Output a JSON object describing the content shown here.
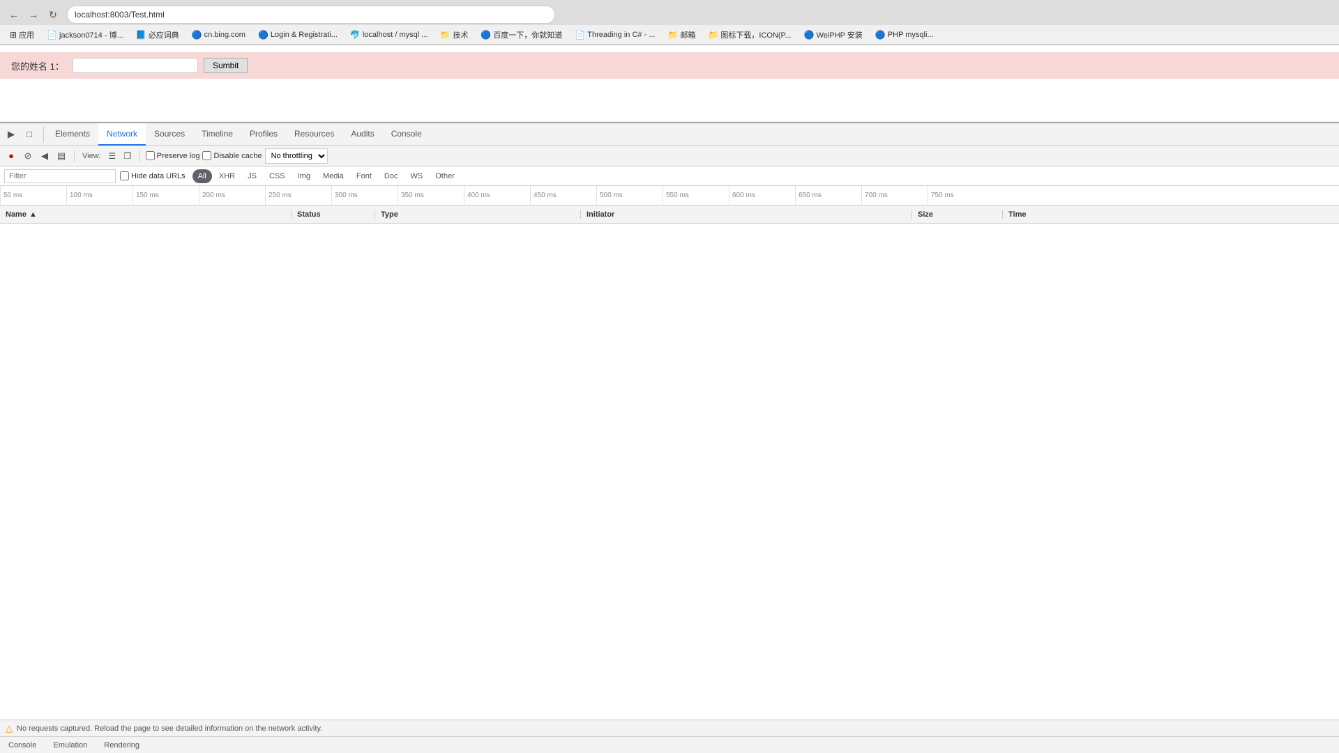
{
  "browser": {
    "url": "localhost:8003/Test.html",
    "back_title": "back",
    "forward_title": "forward",
    "reload_title": "reload"
  },
  "bookmarks": [
    {
      "label": "应用",
      "icon": "⊞"
    },
    {
      "label": "jackson0714 - 博...",
      "icon": "📄"
    },
    {
      "label": "必应词典",
      "icon": "📘"
    },
    {
      "label": "cn.bing.com",
      "icon": "🔵"
    },
    {
      "label": "Login & Registrati...",
      "icon": "🔵"
    },
    {
      "label": "localhost / mysql ...",
      "icon": "🐬"
    },
    {
      "label": "技术",
      "icon": "📁"
    },
    {
      "label": "百度一下，你就知道",
      "icon": "🔵"
    },
    {
      "label": "Threading in C# - ...",
      "icon": "📄"
    },
    {
      "label": "邮箱",
      "icon": "📁"
    },
    {
      "label": "图标下载，ICON(P...",
      "icon": "📁"
    },
    {
      "label": "WeiPHP 安装",
      "icon": "🔵"
    },
    {
      "label": "PHP mysqli...",
      "icon": "🔵"
    }
  ],
  "page": {
    "form_label": "您的姓名 1：",
    "input_placeholder": "",
    "submit_label": "Sumbit"
  },
  "devtools": {
    "tabs": [
      {
        "label": "Elements",
        "active": false
      },
      {
        "label": "Network",
        "active": true
      },
      {
        "label": "Sources",
        "active": false
      },
      {
        "label": "Timeline",
        "active": false
      },
      {
        "label": "Profiles",
        "active": false
      },
      {
        "label": "Resources",
        "active": false
      },
      {
        "label": "Audits",
        "active": false
      },
      {
        "label": "Console",
        "active": false
      }
    ],
    "network": {
      "preserve_log_label": "Preserve log",
      "disable_cache_label": "Disable cache",
      "throttle_label": "No throttling",
      "view_label": "View:",
      "filter_placeholder": "Filter",
      "hide_data_urls_label": "Hide data URLs",
      "filter_types": [
        {
          "label": "All",
          "active": true
        },
        {
          "label": "XHR",
          "active": false
        },
        {
          "label": "JS",
          "active": false
        },
        {
          "label": "CSS",
          "active": false
        },
        {
          "label": "Img",
          "active": false
        },
        {
          "label": "Media",
          "active": false
        },
        {
          "label": "Font",
          "active": false
        },
        {
          "label": "Doc",
          "active": false
        },
        {
          "label": "WS",
          "active": false
        },
        {
          "label": "Other",
          "active": false
        }
      ],
      "timeline_ticks": [
        "50 ms",
        "100 ms",
        "150 ms",
        "200 ms",
        "250 ms",
        "300 ms",
        "350 ms",
        "400 ms",
        "450 ms",
        "500 ms",
        "550 ms",
        "600 ms",
        "650 ms",
        "700 ms",
        "750 ms"
      ],
      "table_headers": {
        "name": "Name",
        "status": "Status",
        "type": "Type",
        "initiator": "Initiator",
        "size": "Size",
        "time": "Time"
      },
      "status_message": "No requests captured. Reload the page to see detailed information on the network activity."
    }
  },
  "bottom_tabs": [
    {
      "label": "Console"
    },
    {
      "label": "Emulation"
    },
    {
      "label": "Rendering"
    }
  ]
}
